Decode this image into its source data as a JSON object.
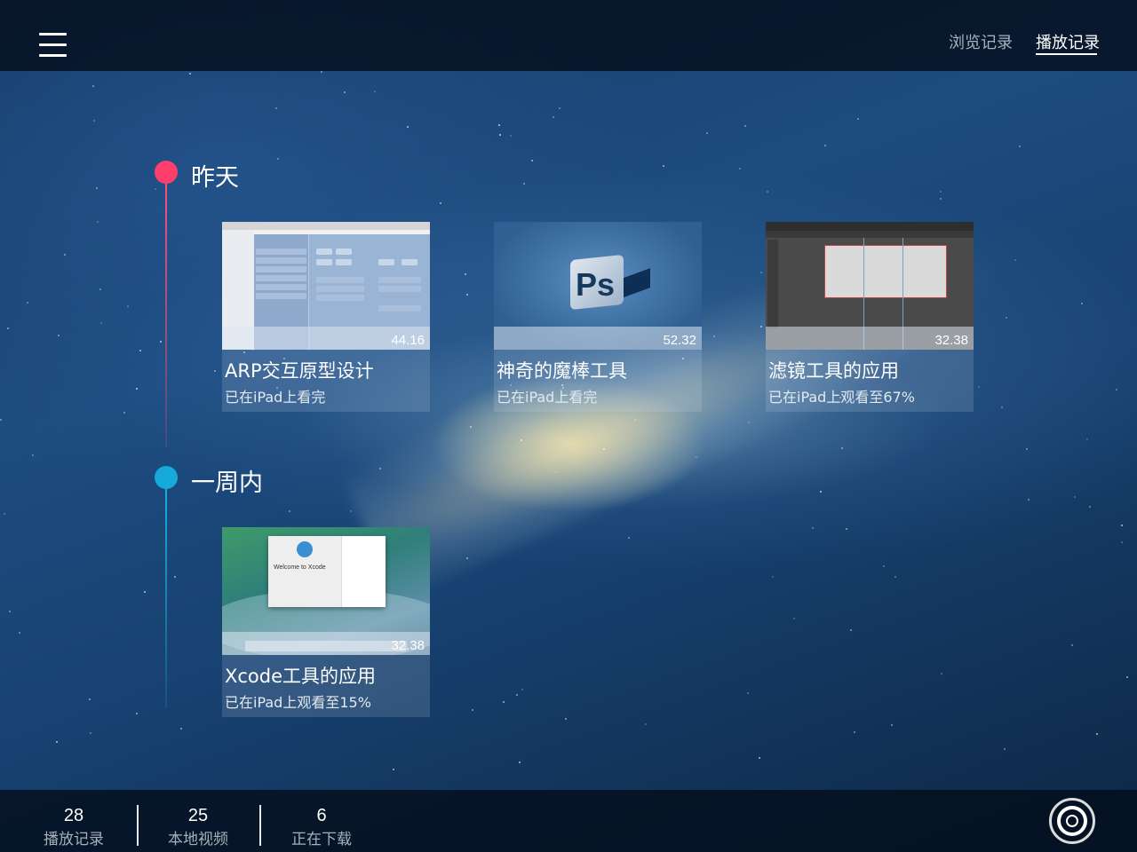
{
  "header": {
    "menu_icon": "hamburger-menu-icon",
    "tabs": [
      {
        "label": "浏览记录",
        "active": false
      },
      {
        "label": "播放记录",
        "active": true
      }
    ]
  },
  "sections": [
    {
      "title": "昨天",
      "color": "#ff3f6b",
      "items": [
        {
          "title": "ARP交互原型设计",
          "status": "已在iPad上看完",
          "duration": "44.16"
        },
        {
          "title": "神奇的魔棒工具",
          "status": "已在iPad上看完",
          "duration": "52.32",
          "thumb_text": "Ps"
        },
        {
          "title": "滤镜工具的应用",
          "status": "已在iPad上观看至67%",
          "duration": "32.38"
        }
      ]
    },
    {
      "title": "一周内",
      "color": "#16a9dc",
      "items": [
        {
          "title": "Xcode工具的应用",
          "status": "已在iPad上观看至15%",
          "duration": "32.38",
          "thumb_text": "Welcome to Xcode"
        }
      ]
    }
  ],
  "footer": {
    "stats": [
      {
        "count": "28",
        "label": "播放记录"
      },
      {
        "count": "25",
        "label": "本地视频"
      },
      {
        "count": "6",
        "label": "正在下载"
      }
    ],
    "action_icon": "record-target-icon"
  }
}
